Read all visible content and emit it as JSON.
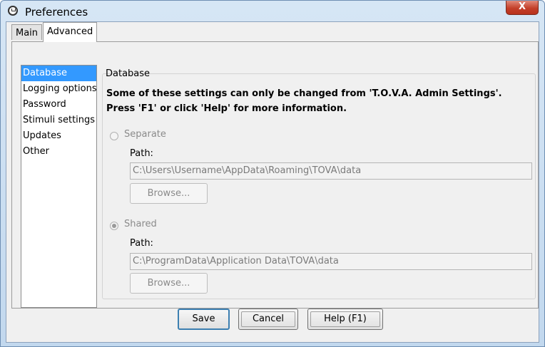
{
  "window": {
    "title": "Preferences",
    "close_glyph": "X"
  },
  "tabs": [
    {
      "label": "Main",
      "selected": false
    },
    {
      "label": "Advanced",
      "selected": true
    }
  ],
  "sidebar": {
    "items": [
      {
        "label": "Database",
        "selected": true
      },
      {
        "label": "Logging options",
        "selected": false
      },
      {
        "label": "Password",
        "selected": false
      },
      {
        "label": "Stimuli settings",
        "selected": false
      },
      {
        "label": "Updates",
        "selected": false
      },
      {
        "label": "Other",
        "selected": false
      }
    ]
  },
  "database": {
    "group_title": "Database",
    "note_line1": "Some of these settings can only be changed from 'T.O.V.A. Admin Settings'.",
    "note_line2": "Press 'F1' or click 'Help' for more information.",
    "separate": {
      "label": "Separate",
      "checked": false,
      "path_label": "Path:",
      "path_value": "C:\\Users\\Username\\AppData\\Roaming\\TOVA\\data",
      "browse_label": "Browse..."
    },
    "shared": {
      "label": "Shared",
      "checked": true,
      "path_label": "Path:",
      "path_value": "C:\\ProgramData\\Application Data\\TOVA\\data",
      "browse_label": "Browse..."
    }
  },
  "buttons": {
    "save": "Save",
    "cancel": "Cancel",
    "help": "Help (F1)"
  },
  "colors": {
    "selection": "#3399ff",
    "disabled_text": "#8a8a8a",
    "close_button": "#c4402a"
  }
}
